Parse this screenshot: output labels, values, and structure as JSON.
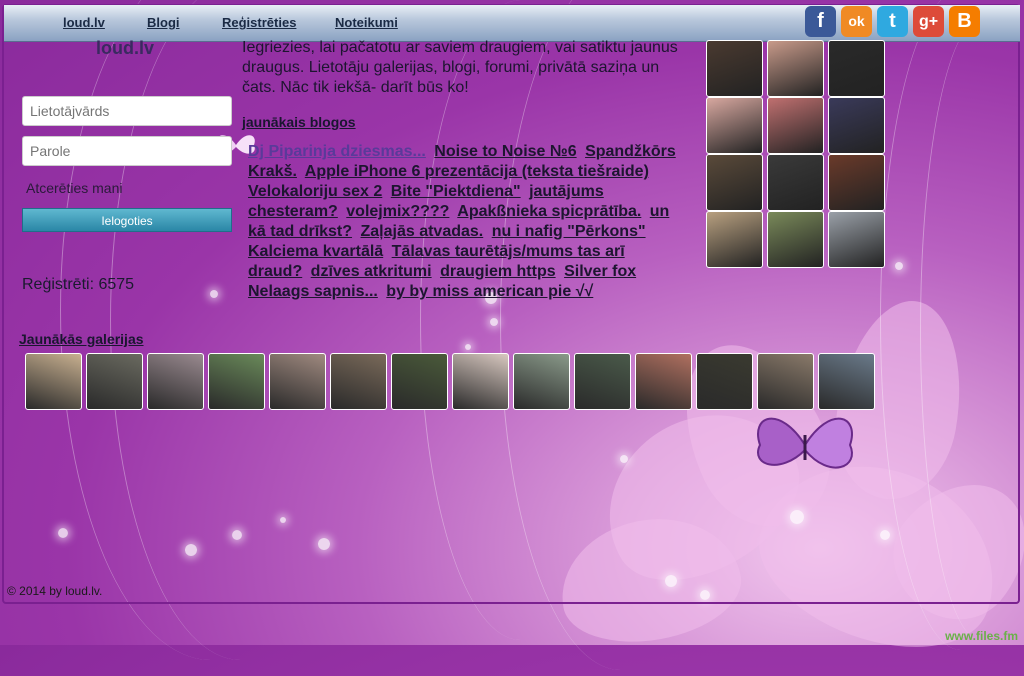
{
  "nav": {
    "items": [
      {
        "label": "loud.lv"
      },
      {
        "label": "Blogi"
      },
      {
        "label": "Reģistrēties"
      },
      {
        "label": "Noteikumi"
      }
    ]
  },
  "social": [
    {
      "icon": "facebook-icon",
      "glyph": "f",
      "color": "#3b5998"
    },
    {
      "icon": "odnoklassniki-icon",
      "glyph": "ok",
      "color": "#f08a24"
    },
    {
      "icon": "twitter-icon",
      "glyph": "t",
      "color": "#2fa9e0"
    },
    {
      "icon": "google-plus-icon",
      "glyph": "g+",
      "color": "#dd4b39"
    },
    {
      "icon": "blogger-icon",
      "glyph": "B",
      "color": "#f57d00"
    }
  ],
  "site_title": "loud.lv",
  "login": {
    "username_placeholder": "Lietotājvārds",
    "password_placeholder": "Parole",
    "remember_label": "Atcerēties mani",
    "login_button": "Ielogoties"
  },
  "registered_label": "Reģistrēti: 6575",
  "intro_text": "Iegriezies, lai pačatotu ar saviem draugiem, vai satiktu jaunus draugus. Lietotāju galerijas, blogi, forumi, privātā saziņa un čats. Nāc tik iekšā- darīt būs ko!",
  "blogs": {
    "heading": "jaunākais blogos",
    "items": [
      "Dj Piparinja dziesmas...",
      "Noise to Noise №6",
      "Spandžkōrs Krakš.",
      "Apple iPhone 6 prezentācija (teksta tiešraide)",
      "Velokaloriju sex 2",
      "Bite \"Piektdiena\"",
      "jautājums chesteram?",
      "volejmix????",
      "Apakßnieka spicprātība.",
      "un kā tad drīkst?",
      "Zaļajās atvadas.",
      "nu i nafig \"Pērkons\" Kalciema kvartālā",
      "Tālavas taurētājs/mums tas arī draud?",
      "dzīves atkritumi",
      "draugiem https",
      "Silver fox",
      "Nelaags sapnis...",
      "by by miss american pie √√"
    ]
  },
  "galleries_heading": "Jaunākās galerijas",
  "footer": "© 2014 by loud.lv.",
  "watermark": "www.files.fm",
  "photo_tones": [
    "#4a3a30",
    "#c89a8a",
    "#2a2a2a",
    "#d8a8a0",
    "#c07070",
    "#3a3a5a",
    "#5a4a3a",
    "#3a3a3a",
    "#6a3a2a",
    "#b8a080",
    "#7a8a5a",
    "#9aa0a8"
  ],
  "gallery_tones": [
    "#c8b090",
    "#6a6a60",
    "#9a8a90",
    "#6a8a5a",
    "#a08a80",
    "#7a6a5a",
    "#4a5a3a",
    "#d8c8c0",
    "#8a9a8a",
    "#4a5a4a",
    "#b07060",
    "#3a3a30",
    "#8a7a6a",
    "#6a7a8a"
  ]
}
